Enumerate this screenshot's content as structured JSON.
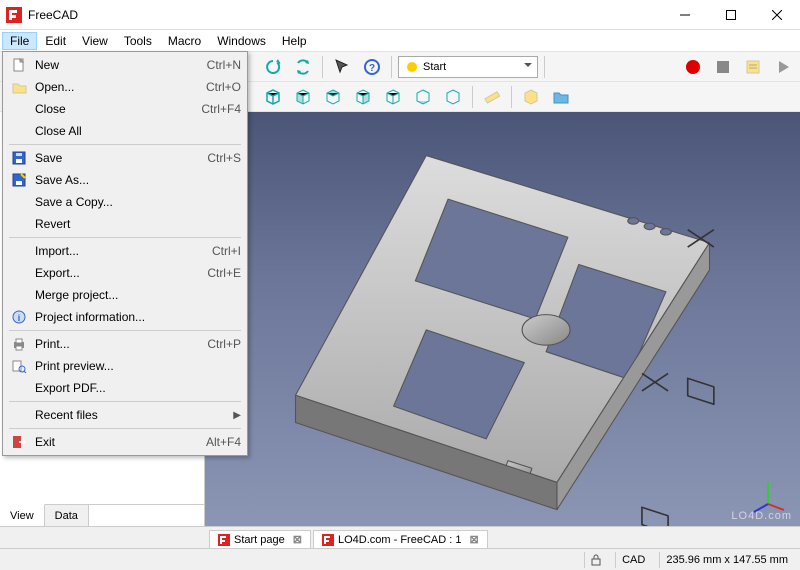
{
  "app": {
    "title": "FreeCAD"
  },
  "menubar": [
    "File",
    "Edit",
    "View",
    "Tools",
    "Macro",
    "Windows",
    "Help"
  ],
  "file_menu": [
    {
      "icon": "new",
      "label": "New",
      "shortcut": "Ctrl+N"
    },
    {
      "icon": "open",
      "label": "Open...",
      "shortcut": "Ctrl+O"
    },
    {
      "label": "Close",
      "shortcut": "Ctrl+F4"
    },
    {
      "label": "Close All"
    },
    "sep",
    {
      "icon": "save",
      "label": "Save",
      "shortcut": "Ctrl+S"
    },
    {
      "icon": "saveas",
      "label": "Save As..."
    },
    {
      "label": "Save a Copy..."
    },
    {
      "label": "Revert"
    },
    "sep",
    {
      "label": "Import...",
      "shortcut": "Ctrl+I"
    },
    {
      "label": "Export...",
      "shortcut": "Ctrl+E"
    },
    {
      "label": "Merge project..."
    },
    {
      "icon": "info",
      "label": "Project information..."
    },
    "sep",
    {
      "icon": "print",
      "label": "Print...",
      "shortcut": "Ctrl+P"
    },
    {
      "icon": "preview",
      "label": "Print preview..."
    },
    {
      "label": "Export PDF..."
    },
    "sep",
    {
      "label": "Recent files",
      "submenu": true
    },
    "sep",
    {
      "icon": "exit",
      "label": "Exit",
      "shortcut": "Alt+F4"
    }
  ],
  "toolbar": {
    "workbench_label": "Start"
  },
  "sidebar_tabs": {
    "view": "View",
    "data": "Data"
  },
  "doc_tabs": [
    {
      "label": "Start page"
    },
    {
      "label": "LO4D.com - FreeCAD : 1"
    }
  ],
  "status": {
    "cad": "CAD",
    "dims": "235.96 mm x 147.55 mm"
  },
  "watermark": "LO4D.com"
}
